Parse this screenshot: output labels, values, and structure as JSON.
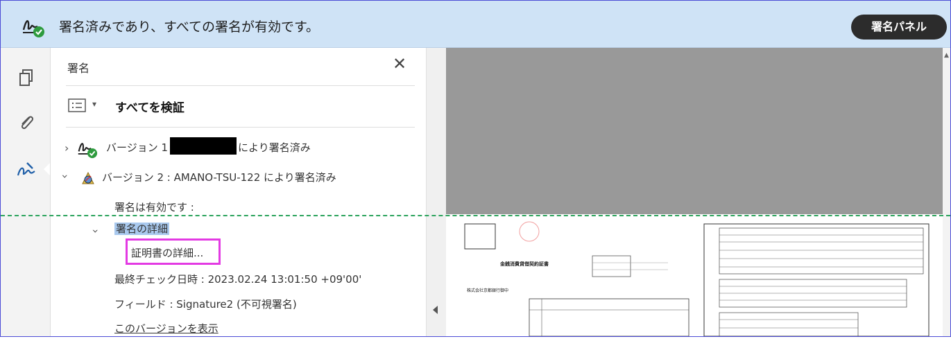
{
  "topbar": {
    "message": "署名済みであり、すべての署名が有効です。",
    "signature_panel_button": "署名パネル"
  },
  "panel": {
    "title": "署名",
    "verify_all": "すべてを検証",
    "version1_prefix": "バージョン 1 :",
    "version1_suffix": "により署名済み",
    "version2": "バージョン 2 : AMANO-TSU-122 により署名済み",
    "signature_valid": "署名は有効です :",
    "signature_details": "署名の詳細",
    "certificate_details": "証明書の詳細...",
    "last_checked": "最終チェック日時 : 2023.02.24 13:01:50 +09'00'",
    "field": "フィールド : Signature2 (不可視署名)",
    "view_version": "このバージョンを表示"
  },
  "document": {
    "doc_title": "金銭消費貸借契約証書",
    "company": "株式会社京都銀行御中"
  },
  "colors": {
    "topbar_bg": "#cfe3f6",
    "highlight_box": "#e33ae3",
    "dashed_line": "#2aa35c",
    "selected_bg": "#a9c9ee"
  }
}
